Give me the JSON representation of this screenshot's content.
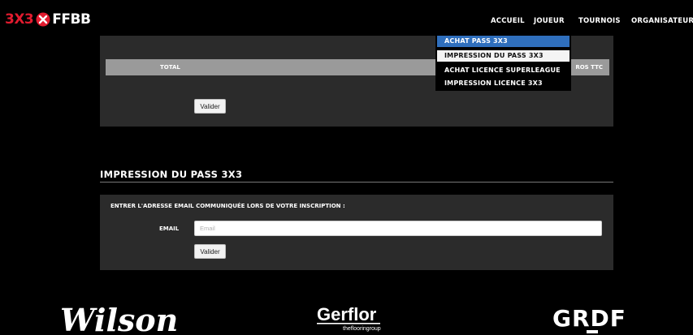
{
  "header": {
    "logo": {
      "part1": "3X3",
      "part2": "FFBB",
      "mark_icon": "3x3-mark-icon",
      "brand_color": "#e21b2f"
    },
    "nav": [
      {
        "label": "ACCUEIL"
      },
      {
        "label": "JOUEUR"
      },
      {
        "label": "TOURNOIS"
      },
      {
        "label": "ORGANISATEURS"
      }
    ]
  },
  "dropdown": {
    "items": [
      {
        "label": "ACHAT PASS 3X3",
        "state": "highlighted"
      },
      {
        "label": "IMPRESSION DU PASS 3X3",
        "state": "hover"
      },
      {
        "label": "ACHAT LICENCE SUPERLEAGUE"
      },
      {
        "label": "IMPRESSION LICENCE 3X3"
      }
    ],
    "highlight_color": "#2f6fbd"
  },
  "cart": {
    "total_label": "TOTAL",
    "total_right": "ROS TTC",
    "submit_label": "Valider"
  },
  "print_pass": {
    "title": "IMPRESSION DU PASS 3X3",
    "instruction": "ENTRER L'ADRESSE EMAIL COMMUNIQUÉE LORS DE VOTRE INSCRIPTION :",
    "email_label": "EMAIL",
    "email_placeholder": "Email",
    "email_value": "",
    "submit_label": "Valider"
  },
  "sponsors": [
    {
      "name": "Wilson",
      "icon": "wilson-logo"
    },
    {
      "name": "Gerflor",
      "tagline": "theflooringroup",
      "icon": "gerflor-logo"
    },
    {
      "name": "GRDF",
      "icon": "grdf-logo"
    }
  ]
}
